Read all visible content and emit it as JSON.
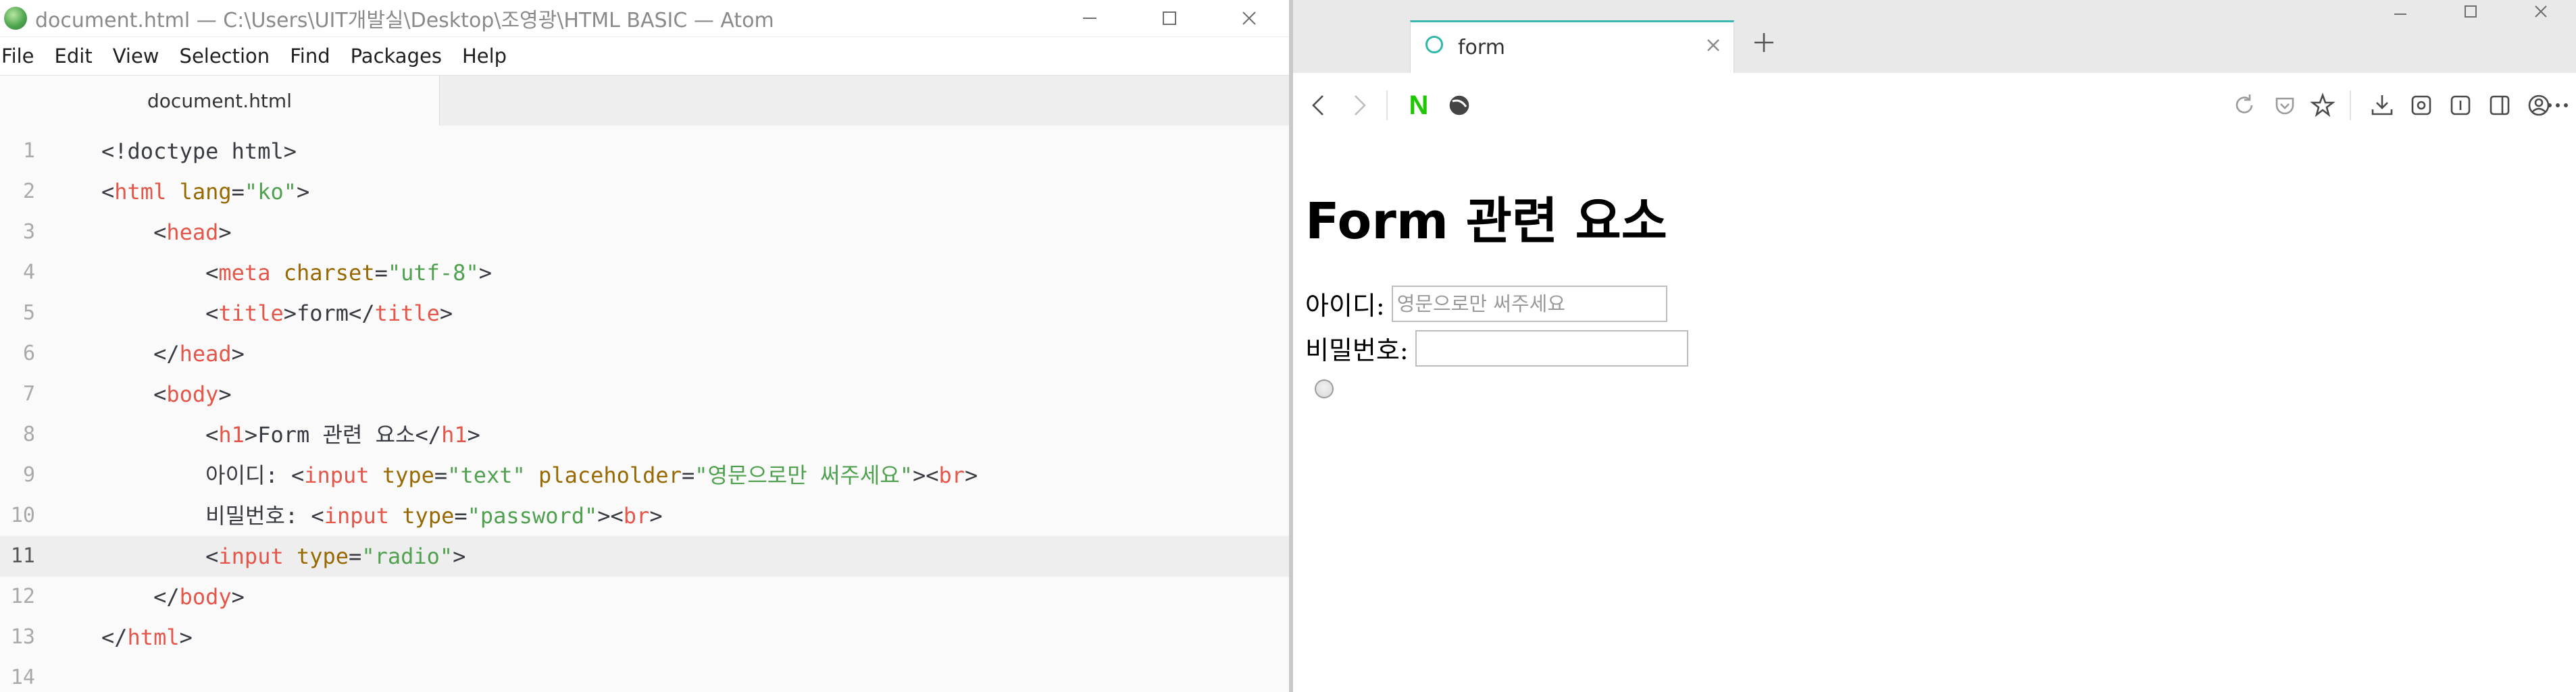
{
  "atom": {
    "window_title": "document.html — C:\\Users\\UIT개발실\\Desktop\\조영광\\HTML BASIC — Atom",
    "menu": [
      "File",
      "Edit",
      "View",
      "Selection",
      "Find",
      "Packages",
      "Help"
    ],
    "tab_title": "document.html",
    "line_numbers": [
      "1",
      "2",
      "3",
      "4",
      "5",
      "6",
      "7",
      "8",
      "9",
      "10",
      "11",
      "12",
      "13",
      "14"
    ],
    "cursor_line": 11
  },
  "browser": {
    "tab_title": "form",
    "new_tab_icon": "plus-icon",
    "toolbar_icons": [
      "back-icon",
      "forward-icon",
      "naver-icon",
      "whale-icon",
      "reload-icon",
      "pocket-icon",
      "star-icon",
      "download-icon",
      "screenshot-icon",
      "reader-icon",
      "sidebar-icon",
      "account-icon",
      "more-icon"
    ],
    "naver_label": "N",
    "page": {
      "heading": "Form 관련 요소",
      "id_label": "아이디:",
      "id_placeholder": "영문으로만 써주세요",
      "pw_label": "비밀번호:"
    }
  },
  "colors": {
    "tag": "#e45649",
    "attr": "#986801",
    "string": "#50a14f",
    "tab_accent": "#3bb6b0",
    "naver_green": "#1ec800"
  }
}
